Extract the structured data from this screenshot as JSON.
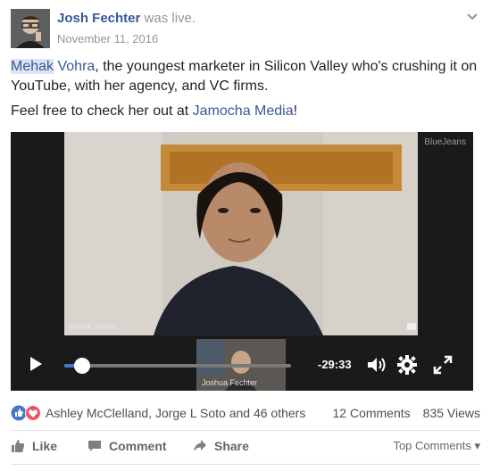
{
  "post": {
    "author": "Josh Fechter",
    "status": " was live.",
    "date": "November 11, 2016",
    "text_tag": "Mehak",
    "text_tag_rest": " Vohra",
    "text_line1_rest": ", the youngest marketer in Silicon Valley who's crushing it on YouTube, with her agency, and VC firms.",
    "text_line2_pre": "Feel free to check her out at ",
    "text_line2_link": "Jamocha Media",
    "text_line2_post": "!"
  },
  "video": {
    "watermark": "BlueJeans",
    "speaker_label": "Mehak Vohra",
    "preview_label": "Joshua Fechter",
    "time_remaining": "-29:33",
    "progress": 0.08
  },
  "reactions": {
    "names": "Ashley McClelland, Jorge L Soto and 46 others",
    "comments": "12 Comments",
    "views": "835 Views"
  },
  "actions": {
    "like": "Like",
    "comment": "Comment",
    "share": "Share",
    "sort": "Top Comments ▾"
  },
  "colors": {
    "link": "#365899",
    "like_blue": "#4a76c9",
    "love_red": "#f25268"
  }
}
